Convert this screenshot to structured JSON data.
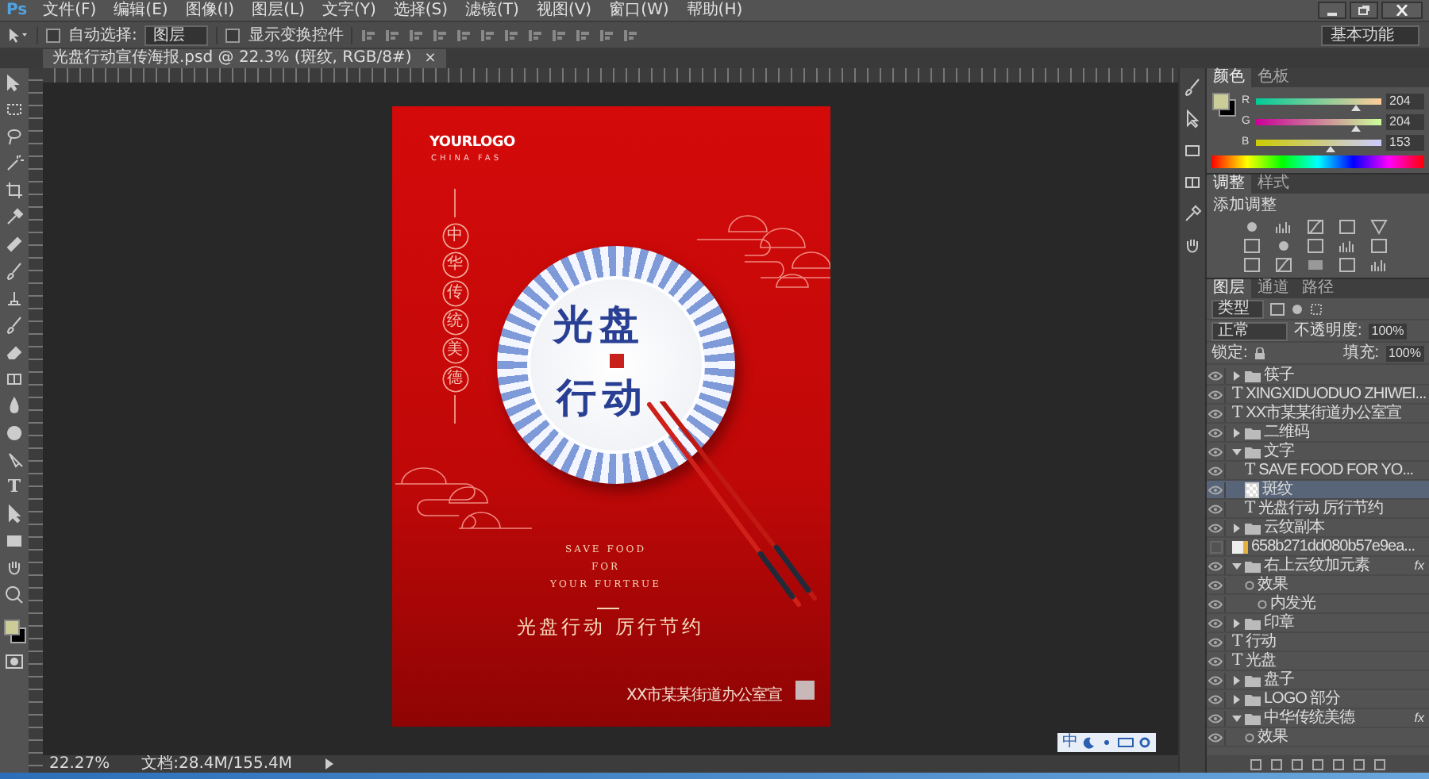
{
  "app_logo": "Ps",
  "menu": [
    "文件(F)",
    "编辑(E)",
    "图像(I)",
    "图层(L)",
    "文字(Y)",
    "选择(S)",
    "滤镜(T)",
    "视图(V)",
    "窗口(W)",
    "帮助(H)"
  ],
  "options": {
    "auto_select": {
      "label": "自动选择:",
      "checked": false
    },
    "auto_select_target": "图层",
    "show_transform": {
      "label": "显示变换控件",
      "checked": false
    },
    "workspace": "基本功能"
  },
  "document_tab": {
    "title": "光盘行动宣传海报.psd @ 22.3% (斑纹, RGB/8#)",
    "close": "×"
  },
  "toolbar": {
    "type_tool": "T"
  },
  "poster": {
    "logo": "YOURLOGO",
    "logo_sub": "CHINA FAS",
    "vertical_text": "中华传统美德",
    "plate_title_1": "光盘",
    "plate_title_2": "行动",
    "slogan_en": [
      "SAVE FOOD",
      "FOR",
      "YOUR FURTRUE"
    ],
    "slogan_cn": "光盘行动 厉行节约",
    "issuer": "XX市某某街道办公室宣"
  },
  "color_panel": {
    "tabs": [
      {
        "label": "颜色",
        "selected": true
      },
      {
        "label": "色板",
        "selected": false
      }
    ],
    "channels": [
      {
        "name": "R",
        "level": 0.8,
        "value": "204"
      },
      {
        "name": "G",
        "level": 0.8,
        "value": "204"
      },
      {
        "name": "B",
        "level": 0.6,
        "value": "153"
      }
    ]
  },
  "adjustments_panel": {
    "tabs": [
      {
        "label": "调整",
        "selected": true
      },
      {
        "label": "样式",
        "selected": false
      }
    ],
    "title": "添加调整"
  },
  "layers_panel": {
    "tabs": [
      {
        "label": "图层",
        "selected": true
      },
      {
        "label": "通道",
        "selected": false
      },
      {
        "label": "路径",
        "selected": false
      }
    ],
    "filter": "类型",
    "blend_mode": "正常",
    "opacity_label": "不透明度:",
    "opacity": "100%",
    "lock_label": "锁定:",
    "fill_label": "填充:",
    "fill": "100%",
    "layers": [
      {
        "kind": "group",
        "name": "筷子",
        "visible": true,
        "selected": false,
        "expanded": false
      },
      {
        "kind": "text",
        "icon": "T",
        "name": "XINGXIDUODUO ZHIWEI...",
        "visible": true,
        "selected": false
      },
      {
        "kind": "text",
        "icon": "T",
        "name": "XX市某某街道办公室宣",
        "visible": true,
        "selected": false
      },
      {
        "kind": "group",
        "name": "二维码",
        "visible": true,
        "selected": false,
        "expanded": false
      },
      {
        "kind": "group",
        "name": "文字",
        "visible": true,
        "selected": false,
        "expanded": true,
        "children": [
          {
            "kind": "text",
            "icon": "T",
            "name": "SAVE FOOD FOR YO...",
            "visible": true,
            "selected": false
          },
          {
            "kind": "pixel",
            "name": "斑纹",
            "visible": true,
            "selected": true
          },
          {
            "kind": "text",
            "icon": "T",
            "name": "光盘行动 厉行节约",
            "visible": true,
            "selected": false
          }
        ]
      },
      {
        "kind": "group",
        "name": "云纹副本",
        "visible": true,
        "selected": false,
        "expanded": false
      },
      {
        "kind": "smart",
        "name": "658b271dd080b57e9ea...",
        "visible": false,
        "selected": false
      },
      {
        "kind": "group",
        "name": "右上云纹加元素",
        "badge": "fx",
        "visible": true,
        "selected": false,
        "expanded": true,
        "children": [
          {
            "kind": "effect",
            "name": "效果",
            "visible": true,
            "selected": false,
            "children": [
              {
                "kind": "effect",
                "name": "内发光",
                "visible": true,
                "selected": false
              }
            ]
          }
        ]
      },
      {
        "kind": "group",
        "name": "印章",
        "visible": true,
        "selected": false,
        "expanded": false
      },
      {
        "kind": "text",
        "icon": "T",
        "name": "行动",
        "visible": true,
        "selected": false
      },
      {
        "kind": "text",
        "icon": "T",
        "name": "光盘",
        "visible": true,
        "selected": false
      },
      {
        "kind": "group",
        "name": "盘子",
        "visible": true,
        "selected": false,
        "expanded": false
      },
      {
        "kind": "group",
        "name": "LOGO 部分",
        "visible": true,
        "selected": false,
        "expanded": false
      },
      {
        "kind": "group",
        "name": "中华传统美德",
        "badge": "fx",
        "visible": true,
        "selected": false,
        "expanded": true,
        "children": [
          {
            "kind": "effect",
            "name": "效果",
            "visible": true,
            "selected": false
          }
        ]
      }
    ]
  },
  "status_bar": {
    "zoom": "22.27%",
    "document": "文档:28.4M/155.4M"
  },
  "ime_bar": {
    "label": "中"
  }
}
